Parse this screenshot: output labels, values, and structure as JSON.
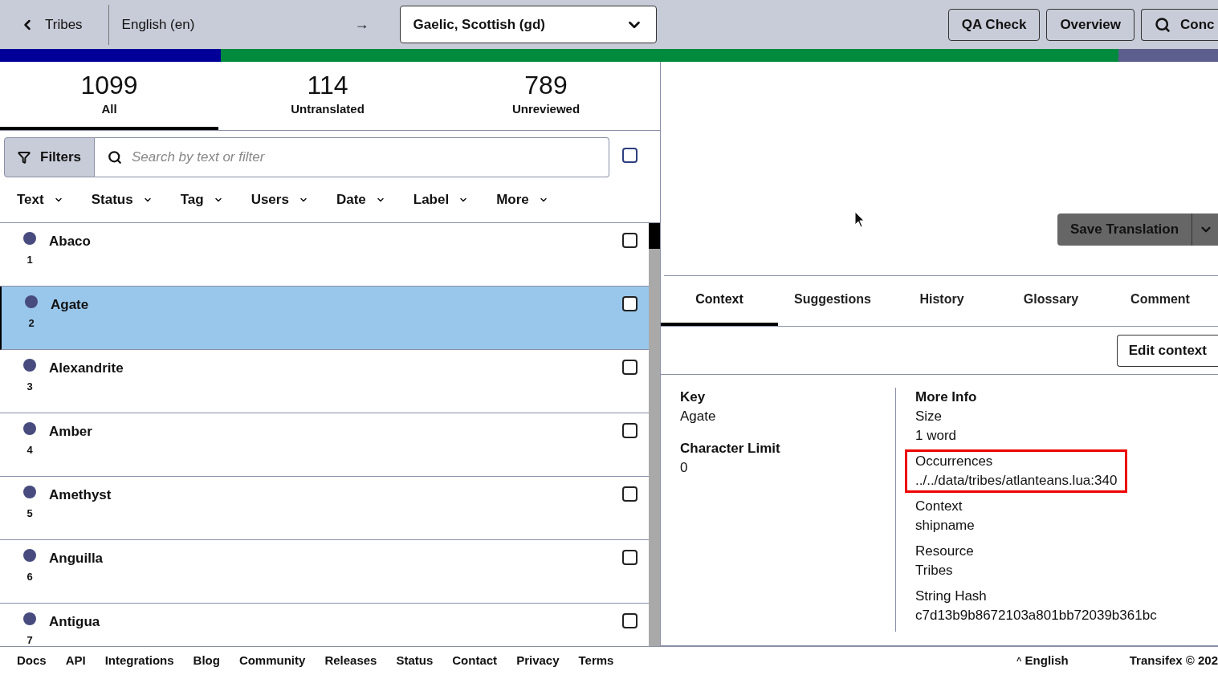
{
  "header": {
    "back_label": "Tribes",
    "source_language": "English (en)",
    "arrow": "→",
    "target_language": "Gaelic, Scottish (gd)",
    "buttons": [
      {
        "kind": "text",
        "label": "QA Check"
      },
      {
        "kind": "text",
        "label": "Overview"
      },
      {
        "kind": "search",
        "label": "Conc"
      }
    ]
  },
  "progress": [
    {
      "color": "#008a3e",
      "level": 0.918
    },
    {
      "color": "#000099",
      "level": 0.181
    }
  ],
  "stat_tabs": [
    {
      "count": "1099",
      "label": "All",
      "selected": true
    },
    {
      "count": "114",
      "label": "Untranslated",
      "selected": false
    },
    {
      "count": "789",
      "label": "Unreviewed",
      "selected": false
    }
  ],
  "filters": {
    "button": "Filters",
    "placeholder": "Search by text or filter",
    "select_all_checked": false,
    "dropdowns": [
      "Text",
      "Status",
      "Tag",
      "Users",
      "Date",
      "Label",
      "More"
    ]
  },
  "strings": [
    {
      "name": "Abaco",
      "number": "1",
      "color": "#474b7e",
      "selected": false,
      "checked": false
    },
    {
      "name": "Agate",
      "number": "2",
      "color": "#474b7e",
      "selected": true,
      "checked": false
    },
    {
      "name": "Alexandrite",
      "number": "3",
      "color": "#474b7e",
      "selected": false,
      "checked": false
    },
    {
      "name": "Amber",
      "number": "4",
      "color": "#474b7e",
      "selected": false,
      "checked": false
    },
    {
      "name": "Amethyst",
      "number": "5",
      "color": "#474b7e",
      "selected": false,
      "checked": false
    },
    {
      "name": "Anguilla",
      "number": "6",
      "color": "#474b7e",
      "selected": false,
      "checked": false
    },
    {
      "name": "Antigua",
      "number": "7",
      "color": "#474b7e",
      "selected": false,
      "checked": false
    }
  ],
  "editor": {
    "save_button": "Save Translation"
  },
  "detail_tabs": [
    {
      "label": "Context",
      "selected": true
    },
    {
      "label": "Suggestions",
      "selected": false
    },
    {
      "label": "History",
      "selected": false
    },
    {
      "label": "Glossary",
      "selected": false
    },
    {
      "label": "Comment",
      "selected": false
    }
  ],
  "edit_context_button": "Edit context",
  "key": {
    "title": "Key",
    "value": "Agate"
  },
  "character_limit": {
    "title": "Character Limit",
    "value": "0"
  },
  "more_info": {
    "title": "More Info",
    "items": [
      {
        "label": "Size",
        "value": "1 word",
        "highlighted": false
      },
      {
        "label": "Occurrences",
        "value": "../../data/tribes/atlanteans.lua:340",
        "highlighted": true
      },
      {
        "label": "Context",
        "value": "shipname",
        "highlighted": false
      },
      {
        "label": "Resource",
        "value": "Tribes",
        "highlighted": false
      },
      {
        "label": "String Hash",
        "value": "c7d13b9b8672103a801bb72039b361bc",
        "highlighted": false
      }
    ]
  },
  "footer": {
    "links": [
      "Docs",
      "API",
      "Integrations",
      "Blog",
      "Community",
      "Releases",
      "Status",
      "Contact",
      "Privacy",
      "Terms"
    ],
    "language": "English",
    "caret": "^",
    "copyright": "Transifex © 202"
  }
}
